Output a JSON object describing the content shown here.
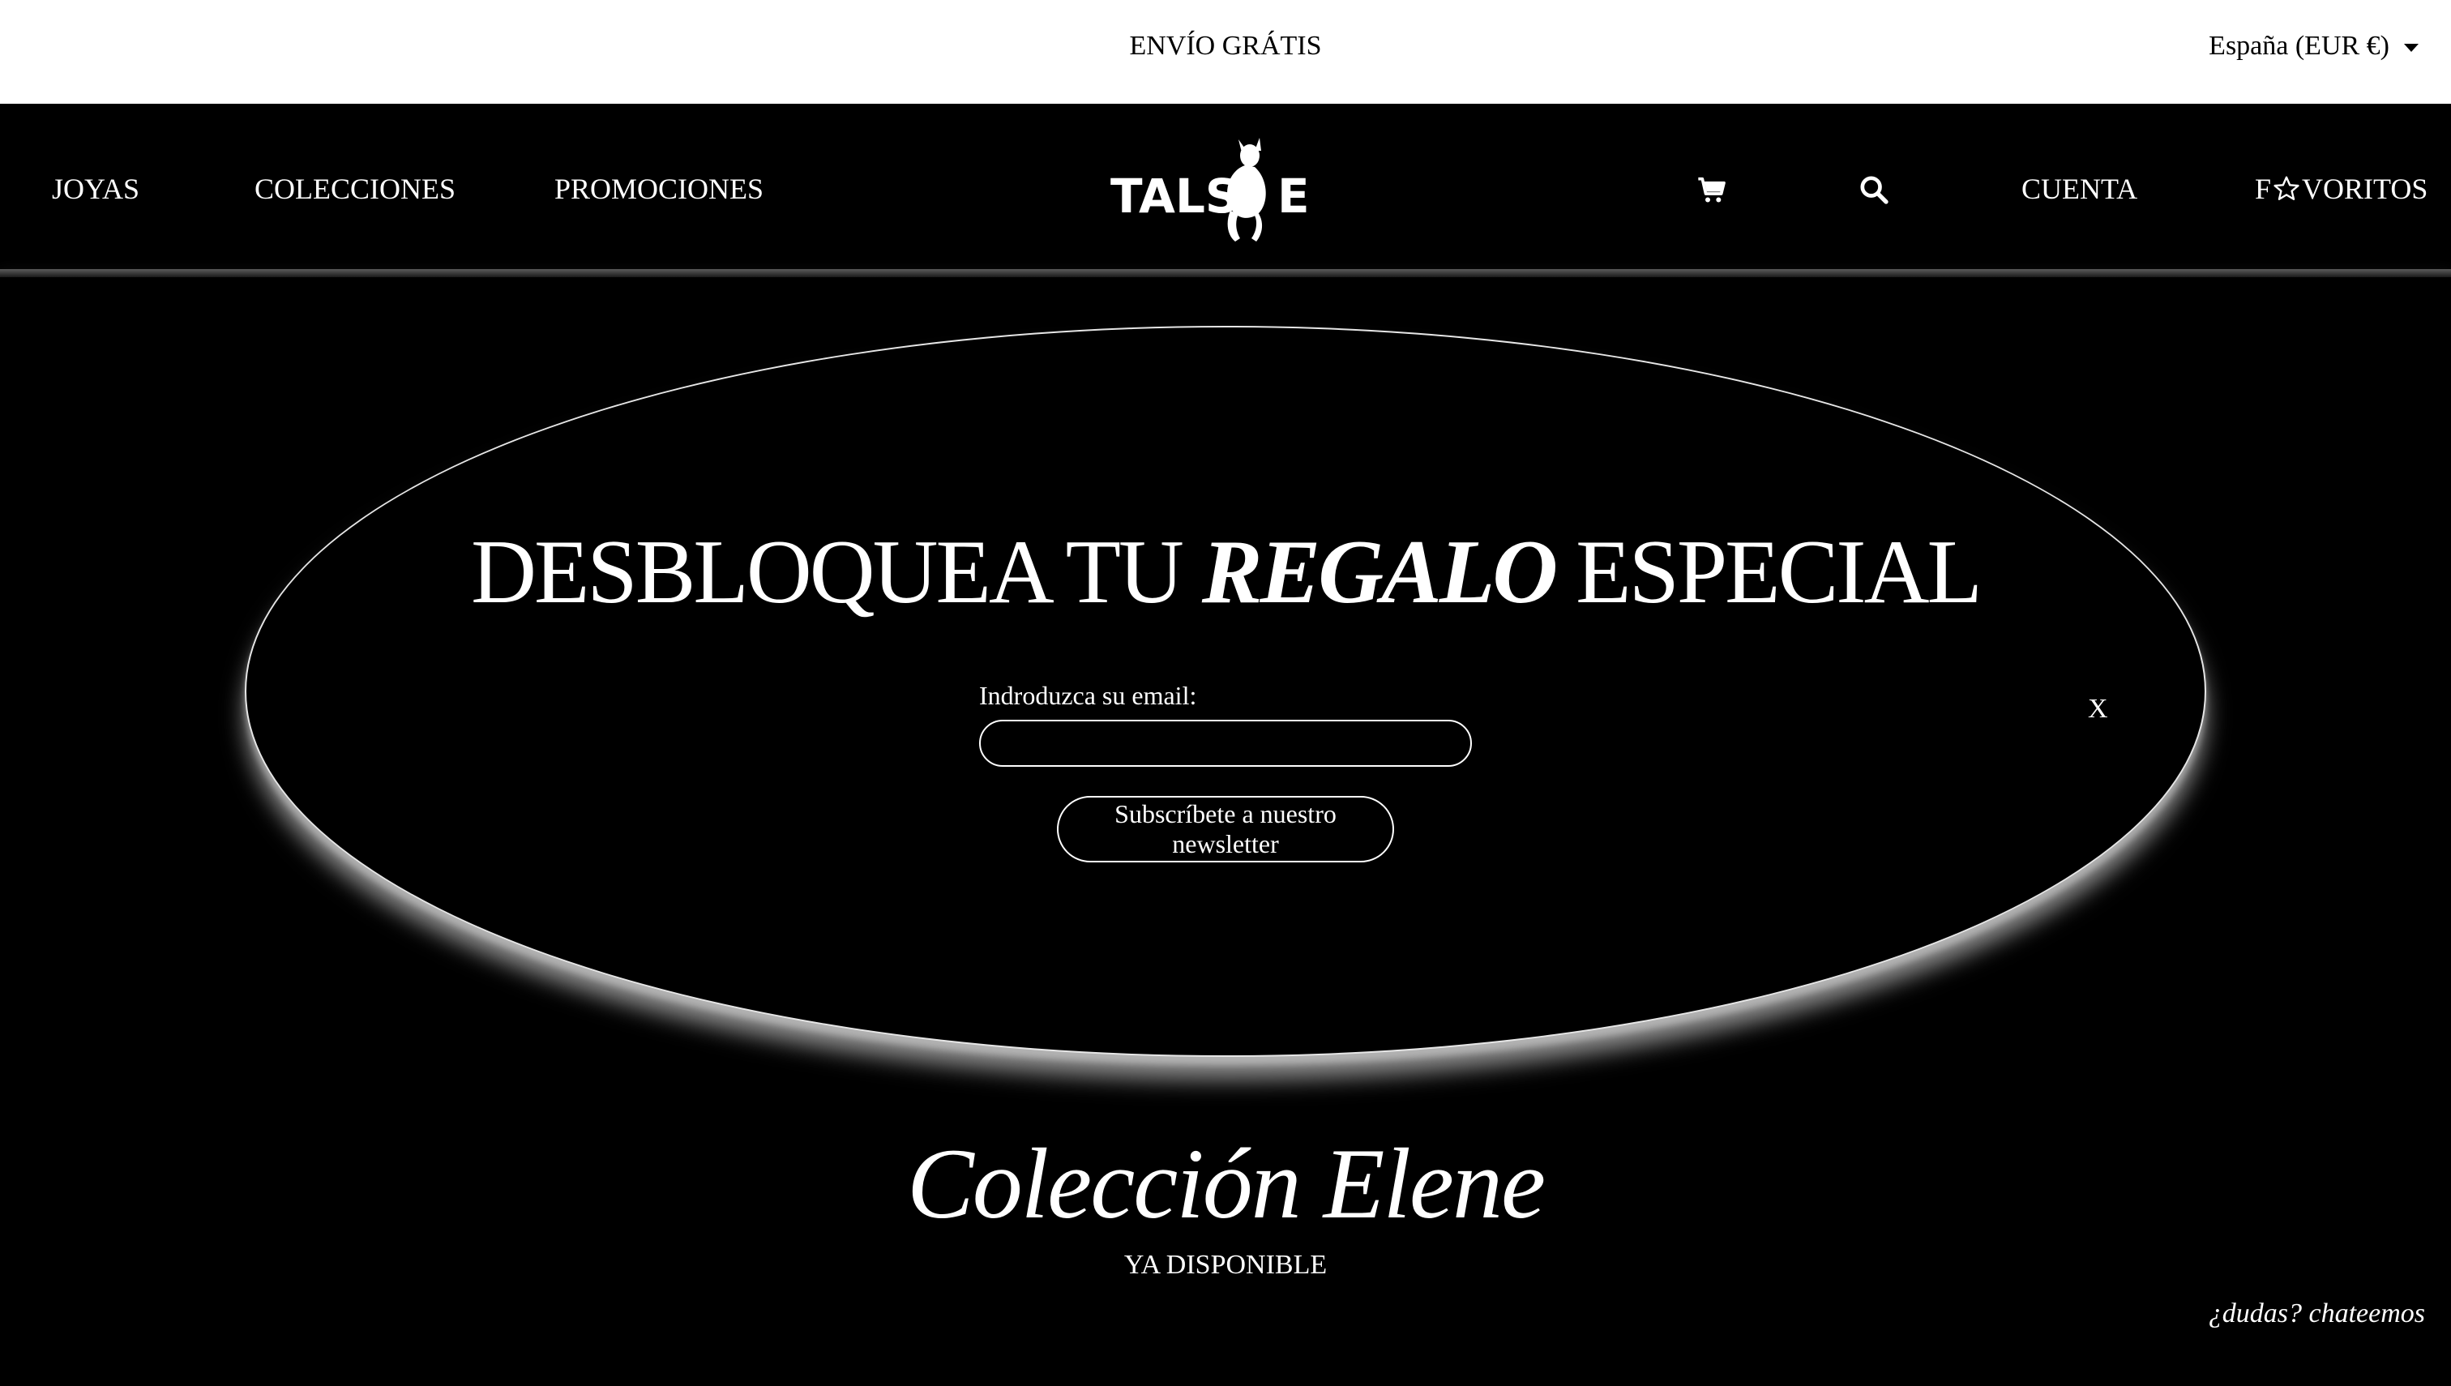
{
  "topbar": {
    "shipping": "ENVÍO GRÁTIS",
    "region": "España (EUR €)"
  },
  "header": {
    "nav": {
      "joyas": "JOYAS",
      "colecciones": "COLECCIONES",
      "promociones": "PROMOCIONES",
      "cuenta": "CUENTA",
      "favoritos_prefix": "F",
      "favoritos_suffix": "VORITOS"
    },
    "logo_text": "TALSE",
    "icons": [
      "cart-icon",
      "search-icon",
      "star-icon"
    ]
  },
  "popup": {
    "headline_part1": "DESBLOQUEA TU ",
    "headline_em": "REGALO",
    "headline_part2": " ESPECIAL",
    "email_label": "Indroduzca su email:",
    "email_value": "",
    "subscribe_label": "Subscríbete a nuestro newsletter",
    "close_label": "X"
  },
  "collection": {
    "title": "Colección Elene",
    "subtitle": "YA DISPONIBLE"
  },
  "chat": {
    "label": "¿dudas? chateemos"
  },
  "colors": {
    "background": "#000000",
    "topbar": "#ffffff",
    "text_light": "#ffffff",
    "text_dark": "#000000"
  }
}
